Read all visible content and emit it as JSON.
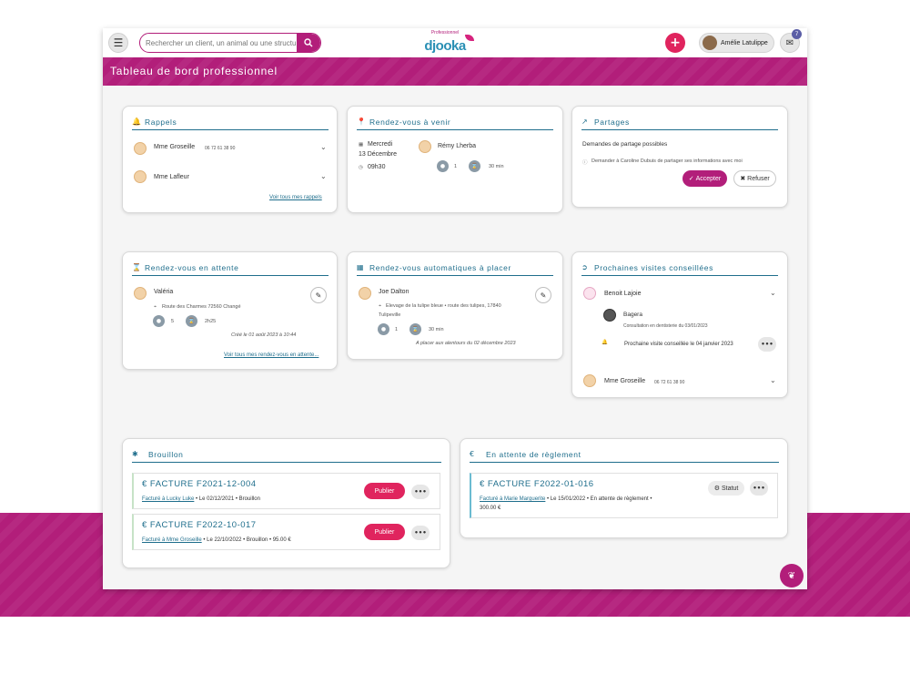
{
  "header": {
    "search_placeholder": "Rechercher un client, un animal ou une structure",
    "logo_sub": "Professionnel",
    "logo_main": "djooka",
    "user_name": "Amélie Latulippe",
    "notif_count": "7"
  },
  "page": {
    "title": "Tableau de bord professionnel"
  },
  "rappels": {
    "title": "Rappels",
    "items": [
      {
        "name": "Mme Groseille",
        "phone": "06 72 61 38 90"
      },
      {
        "name": "Mme Lafleur",
        "phone": ""
      }
    ],
    "see_all": "Voir tous mes rappels"
  },
  "rdv_venir": {
    "title": "Rendez-vous à venir",
    "day": "Mercredi",
    "date": "13 Décembre",
    "time": "09h30",
    "client": "Rémy Lherba",
    "count": "1",
    "duration": "30 min"
  },
  "partages": {
    "title": "Partages",
    "subtitle": "Demandes de partage possibles",
    "request": "Demander à Caroline Dubuis de partager ses informations avec moi",
    "accept": "Accepter",
    "refuse": "Refuser"
  },
  "rdv_attente": {
    "title": "Rendez-vous en attente",
    "client": "Valéria",
    "address": "Route des Charmes 72560 Changé",
    "count": "5",
    "duration": "2h25",
    "created": "Créé le 01 août 2023 à 10:44",
    "see_all": "Voir tous mes rendez-vous en attente..."
  },
  "rdv_auto": {
    "title": "Rendez-vous automatiques à placer",
    "client": "Joe Dalton",
    "address_1": "Elevage de la tulipe bleue • route des tulipes, 17840",
    "address_2": "Tulipeville",
    "count": "1",
    "duration": "30 min",
    "note": "A placer aux alentours du 02 décembre 2023"
  },
  "visites": {
    "title": "Prochaines visites conseillées",
    "client_1": "Benoit Lajoie",
    "animal": "Bagera",
    "consult": "Consultation en dentisterie du 03/01/2023",
    "next": "Prochaine visite conseillée le 04 janvier 2023",
    "client_2": "Mme Groseille",
    "phone_2": "06 72 61 38 90"
  },
  "brouillon": {
    "title": "Brouillon",
    "publish": "Publier",
    "invoices": [
      {
        "number": "€  FACTURE F2021-12-004",
        "billed": "Facturé à Lucky Luke",
        "rest": " • Le 02/12/2021 • Brouillon"
      },
      {
        "number": "€  FACTURE F2022-10-017",
        "billed": "Facturé à Mme Groseille",
        "rest": " • Le 22/10/2022 • Brouillon • 95.00 €"
      }
    ]
  },
  "attente_reglement": {
    "title": "En attente de règlement",
    "statut": "Statut",
    "invoice": {
      "number": "€  FACTURE F2022-01-016",
      "billed": "Facturé à Marie Marguerite",
      "rest": " • Le 15/01/2022 • En attente de règlement •",
      "amount": "300.00 €"
    }
  },
  "colors": {
    "brand": "#b21e7a",
    "accent": "#1f6e8c",
    "cta": "#e0245e"
  }
}
